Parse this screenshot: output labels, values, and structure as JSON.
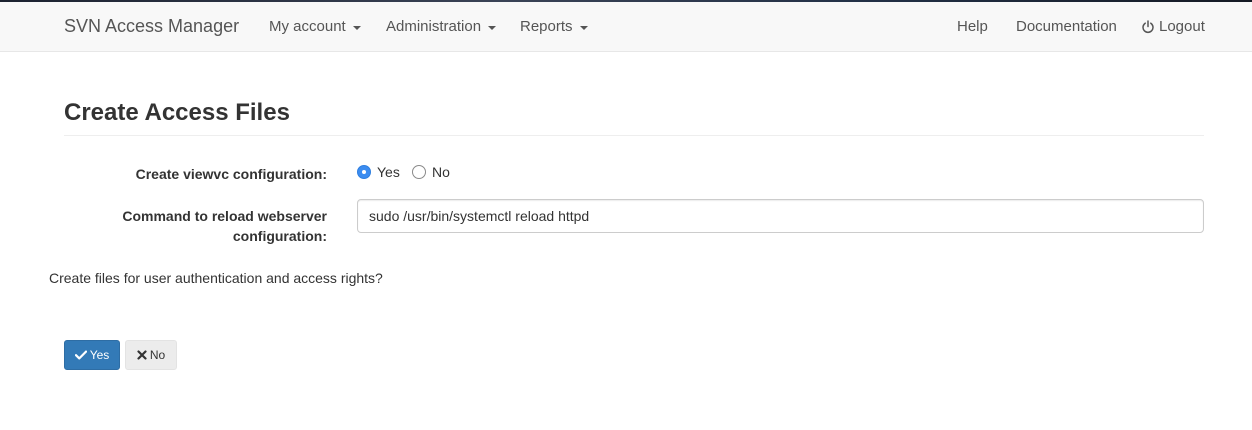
{
  "navbar": {
    "brand": "SVN Access Manager",
    "menus": [
      {
        "label": "My account"
      },
      {
        "label": "Administration"
      },
      {
        "label": "Reports"
      }
    ],
    "right_links": [
      {
        "label": "Help"
      },
      {
        "label": "Documentation"
      },
      {
        "label": "Logout",
        "icon": "power-icon"
      }
    ]
  },
  "page": {
    "title": "Create Access Files"
  },
  "form": {
    "viewvc": {
      "label": "Create viewvc configuration:",
      "options": [
        {
          "label": "Yes",
          "checked": true
        },
        {
          "label": "No",
          "checked": false
        }
      ]
    },
    "reload_command": {
      "label_line1": "Command to reload webserver",
      "label_line2": "configuration:",
      "value": "sudo /usr/bin/systemctl reload httpd"
    }
  },
  "question": "Create files for user authentication and access rights?",
  "buttons": {
    "yes": {
      "label": "Yes",
      "icon": "check-icon"
    },
    "no": {
      "label": "No",
      "icon": "times-icon"
    }
  },
  "colors": {
    "primary": "#337ab7",
    "radio_checked": "#3b8cf0",
    "navbar_bg": "#f8f8f8"
  }
}
